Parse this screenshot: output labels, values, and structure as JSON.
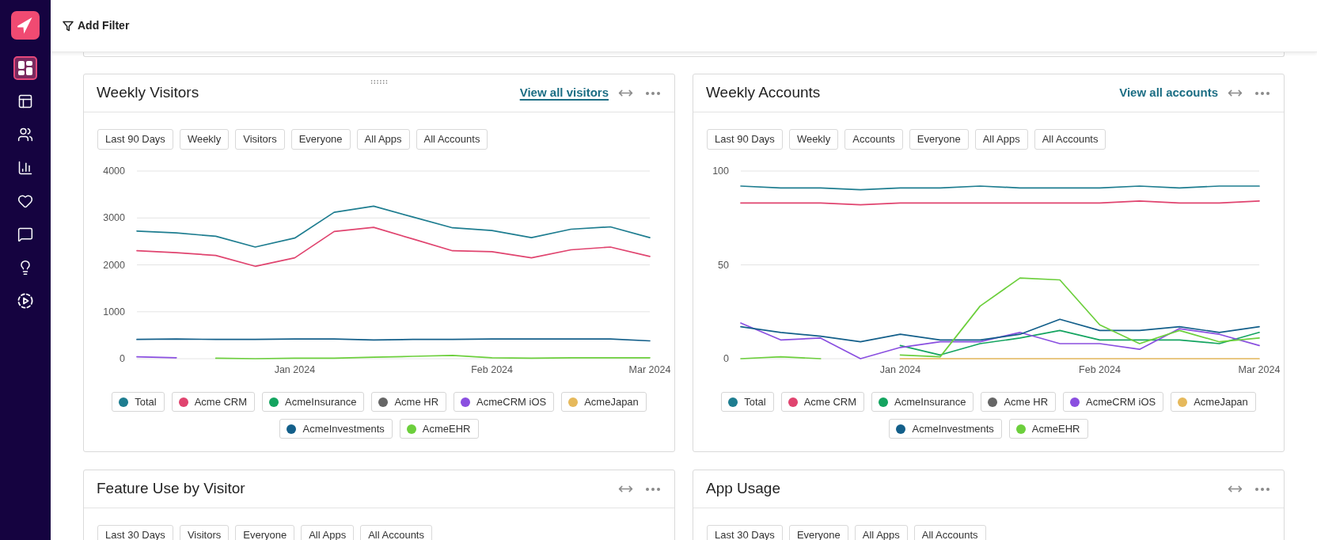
{
  "sidebar": {
    "items": [
      {
        "selected": true
      },
      {
        "selected": false
      },
      {
        "selected": false
      },
      {
        "selected": false
      },
      {
        "selected": false
      },
      {
        "selected": false
      },
      {
        "selected": false
      },
      {
        "selected": false
      }
    ]
  },
  "top_bar": {
    "add_filter": "Add Filter"
  },
  "cards": [
    {
      "title": "Weekly Visitors",
      "hovered": true,
      "link": {
        "label": "View all visitors",
        "hovered": true
      },
      "filters": [
        "Last 90 Days",
        "Weekly",
        "Visitors",
        "Everyone",
        "All Apps",
        "All Accounts"
      ],
      "chart_data": {
        "type": "line",
        "grid": true,
        "legend": "bottom",
        "categories": [
          null,
          null,
          null,
          null,
          "Jan 2024",
          null,
          null,
          null,
          null,
          "Feb 2024",
          null,
          null,
          null,
          "Mar 2024"
        ],
        "ylim": [
          0,
          4000
        ],
        "yticks": [
          0,
          1000,
          2000,
          3000,
          4000
        ],
        "series": [
          {
            "name": "Total",
            "color": "#1e7d90",
            "values": [
              2720,
              2680,
              2610,
              2380,
              2570,
              3120,
              3250,
              3020,
              2790,
              2730,
              2580,
              2760,
              2810,
              2580
            ]
          },
          {
            "name": "Acme CRM",
            "color": "#e0446f",
            "values": [
              2300,
              2260,
              2200,
              1970,
              2150,
              2710,
              2800,
              2550,
              2300,
              2280,
              2150,
              2320,
              2380,
              2180
            ]
          },
          {
            "name": "AcmeInsurance",
            "color": "#14a460",
            "values": [
              null,
              null,
              null,
              null,
              null,
              null,
              null,
              null,
              null,
              null,
              null,
              null,
              null,
              null
            ]
          },
          {
            "name": "Acme HR",
            "color": "#666666",
            "values": [
              null,
              null,
              null,
              null,
              null,
              null,
              null,
              null,
              null,
              null,
              null,
              null,
              null,
              null
            ]
          },
          {
            "name": "AcmeCRM iOS",
            "color": "#8a4fe0",
            "values": [
              40,
              20,
              null,
              null,
              null,
              null,
              null,
              null,
              null,
              null,
              null,
              null,
              null,
              null
            ]
          },
          {
            "name": "AcmeJapan",
            "color": "#e6b95c",
            "values": [
              null,
              null,
              null,
              null,
              null,
              null,
              null,
              null,
              null,
              null,
              null,
              null,
              null,
              null
            ]
          },
          {
            "name": "AcmeInvestments",
            "color": "#135f8a",
            "values": [
              410,
              420,
              410,
              410,
              420,
              420,
              400,
              410,
              410,
              420,
              420,
              420,
              420,
              380
            ]
          },
          {
            "name": "AcmeEHR",
            "color": "#6ccf3c",
            "values": [
              null,
              null,
              10,
              0,
              10,
              10,
              30,
              50,
              70,
              20,
              10,
              20,
              20,
              20
            ]
          }
        ]
      }
    },
    {
      "title": "Weekly Accounts",
      "hovered": false,
      "link": {
        "label": "View all accounts",
        "hovered": false
      },
      "filters": [
        "Last 90 Days",
        "Weekly",
        "Accounts",
        "Everyone",
        "All Apps",
        "All Accounts"
      ],
      "chart_data": {
        "type": "line",
        "grid": true,
        "legend": "bottom",
        "categories": [
          null,
          null,
          null,
          null,
          "Jan 2024",
          null,
          null,
          null,
          null,
          "Feb 2024",
          null,
          null,
          null,
          "Mar 2024"
        ],
        "ylim": [
          0,
          100
        ],
        "yticks": [
          0,
          50,
          100
        ],
        "series": [
          {
            "name": "Total",
            "color": "#1e7d90",
            "values": [
              92,
              91,
              91,
              90,
              91,
              91,
              92,
              91,
              91,
              91,
              92,
              91,
              92,
              92
            ]
          },
          {
            "name": "Acme CRM",
            "color": "#e0446f",
            "values": [
              83,
              83,
              83,
              82,
              83,
              83,
              83,
              83,
              83,
              83,
              84,
              83,
              83,
              84
            ]
          },
          {
            "name": "AcmeInsurance",
            "color": "#14a460",
            "values": [
              null,
              null,
              null,
              null,
              7,
              2,
              8,
              11,
              15,
              10,
              10,
              10,
              8,
              14
            ]
          },
          {
            "name": "Acme HR",
            "color": "#666666",
            "values": [
              null,
              null,
              null,
              null,
              null,
              null,
              null,
              null,
              null,
              null,
              null,
              null,
              null,
              null
            ]
          },
          {
            "name": "AcmeCRM iOS",
            "color": "#8a4fe0",
            "values": [
              19,
              10,
              11,
              0,
              6,
              9,
              9,
              14,
              8,
              8,
              5,
              16,
              13,
              7
            ]
          },
          {
            "name": "AcmeJapan",
            "color": "#e6b95c",
            "values": [
              null,
              null,
              null,
              null,
              0,
              0,
              0,
              0,
              0,
              0,
              0,
              0,
              0,
              0
            ]
          },
          {
            "name": "AcmeInvestments",
            "color": "#135f8a",
            "values": [
              17,
              14,
              12,
              9,
              13,
              10,
              10,
              13,
              21,
              15,
              15,
              17,
              14,
              17
            ]
          },
          {
            "name": "AcmeEHR",
            "color": "#6ccf3c",
            "values": [
              0,
              1,
              0,
              null,
              2,
              1,
              28,
              43,
              42,
              18,
              8,
              15,
              9,
              11
            ]
          }
        ]
      }
    },
    {
      "title": "Feature Use by Visitor",
      "hovered": false,
      "filters": [
        "Last 30 Days",
        "Visitors",
        "Everyone",
        "All Apps",
        "All Accounts"
      ]
    },
    {
      "title": "App Usage",
      "hovered": false,
      "filters": [
        "Last 30 Days",
        "Everyone",
        "All Apps",
        "All Accounts"
      ]
    }
  ]
}
